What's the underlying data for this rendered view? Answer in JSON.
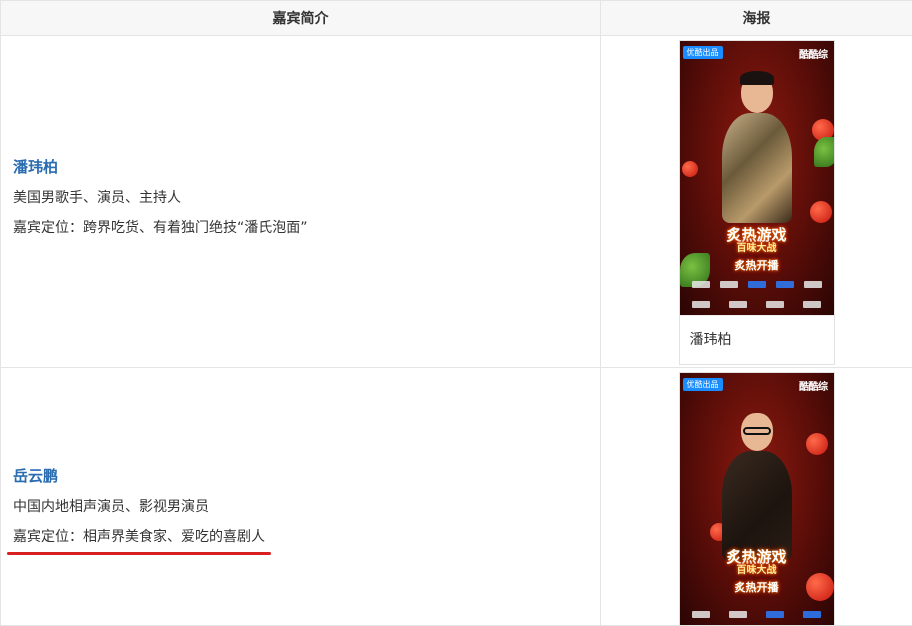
{
  "table": {
    "headers": {
      "intro": "嘉宾简介",
      "poster": "海报"
    }
  },
  "guests": [
    {
      "name": "潘玮柏",
      "description": "美国男歌手、演员、主持人",
      "positioning": "嘉宾定位：跨界吃货、有着独门绝技“潘氏泡面”",
      "poster": {
        "badge": "优酷出品",
        "brand": "酷酷综",
        "title_main": "炙热游戏",
        "title_sub": "百味大战",
        "slogan": "炙热开播",
        "caption": "潘玮柏"
      }
    },
    {
      "name": "岳云鹏",
      "description": "中国内地相声演员、影视男演员",
      "positioning": "嘉宾定位：相声界美食家、爱吃的喜剧人",
      "poster": {
        "badge": "优酷出品",
        "brand": "酷酷综",
        "title_main": "炙热游戏",
        "title_sub": "百味大战",
        "slogan": "炙热开播"
      }
    }
  ],
  "colors": {
    "name_link": "#2a6cb0",
    "underline": "#d8201e",
    "header_bg": "#f7f7f7",
    "border": "#e4e4e4"
  }
}
